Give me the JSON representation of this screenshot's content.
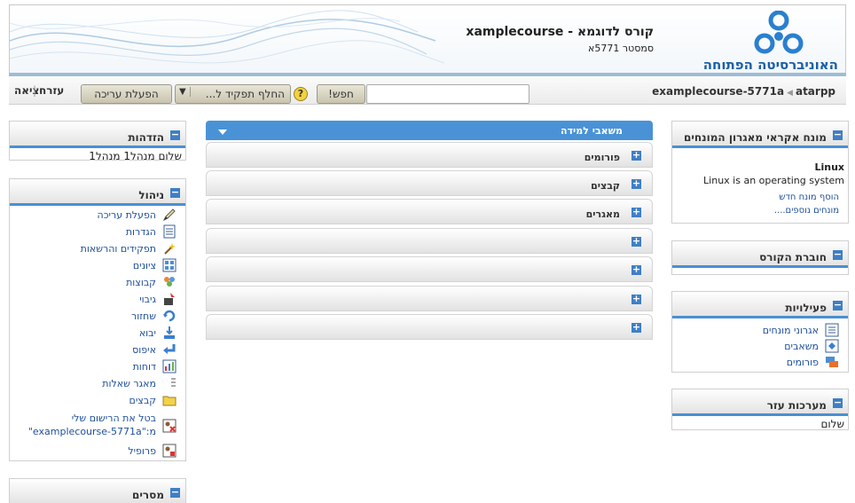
{
  "header": {
    "university_name": "האוניברסיטה הפתוחה",
    "course_title": "קורס לדוגמא - xamplecourse",
    "semester": "סמסטר 5771א"
  },
  "navbar": {
    "breadcrumb_root": "atarpp",
    "breadcrumb_course": "examplecourse-5771a",
    "search_button": "חפש!",
    "switch_role": "החלף תפקיד ל...",
    "edit_button": "הפעלת עריכה",
    "help_link": "עזרה",
    "logout_link": "יציאה"
  },
  "left": {
    "greeting": {
      "title": "הזדהות",
      "text": "שלום מנהל1 מנהל1"
    },
    "admin": {
      "title": "ניהול",
      "items": [
        {
          "label": "הפעלת עריכה",
          "icon": "edit-icon"
        },
        {
          "label": "הגדרות",
          "icon": "settings-icon"
        },
        {
          "label": "תפקידים והרשאות",
          "icon": "roles-icon"
        },
        {
          "label": "ציונים",
          "icon": "grades-icon"
        },
        {
          "label": "קבוצות",
          "icon": "groups-icon"
        },
        {
          "label": "גיבוי",
          "icon": "backup-icon"
        },
        {
          "label": "שחזור",
          "icon": "restore-icon"
        },
        {
          "label": "יבוא",
          "icon": "import-icon"
        },
        {
          "label": "איפוס",
          "icon": "reset-icon"
        },
        {
          "label": "דוחות",
          "icon": "reports-icon"
        },
        {
          "label": "מאגר שאלות",
          "icon": "questions-icon"
        },
        {
          "label": "קבצים",
          "icon": "folder-icon"
        },
        {
          "label": "בטל את הרישום שלי מ:\"examplecourse-5771a\"",
          "icon": "unenrol-icon"
        },
        {
          "label": "פרופיל",
          "icon": "profile-icon"
        }
      ]
    },
    "messages": {
      "title": "מסרים"
    }
  },
  "center": {
    "top_section": "משאבי למידה",
    "sections": [
      "פורומים",
      "קבצים",
      "מאגרים",
      "",
      "",
      "",
      ""
    ]
  },
  "right": {
    "glossary": {
      "title": "מונח אקראי מאגרון המונחים",
      "term": "Linux",
      "definition": "Linux is an operating system",
      "add_link": "הוסף מונח חדש",
      "more_link": "מונחים נוספים...."
    },
    "course_book": {
      "title": "חוברת הקורס"
    },
    "activities": {
      "title": "פעילויות",
      "items": [
        {
          "label": "אגרוני מונחים",
          "icon": "glossary-icon"
        },
        {
          "label": "משאבים",
          "icon": "resources-icon"
        },
        {
          "label": "פורומים",
          "icon": "forum-icon"
        }
      ]
    },
    "helper": {
      "title": "מערכות עזר",
      "text": "שלום"
    }
  },
  "colors": {
    "accent": "#4a8fd3",
    "link": "#1e4f99",
    "logo": "#1a5fa6"
  }
}
